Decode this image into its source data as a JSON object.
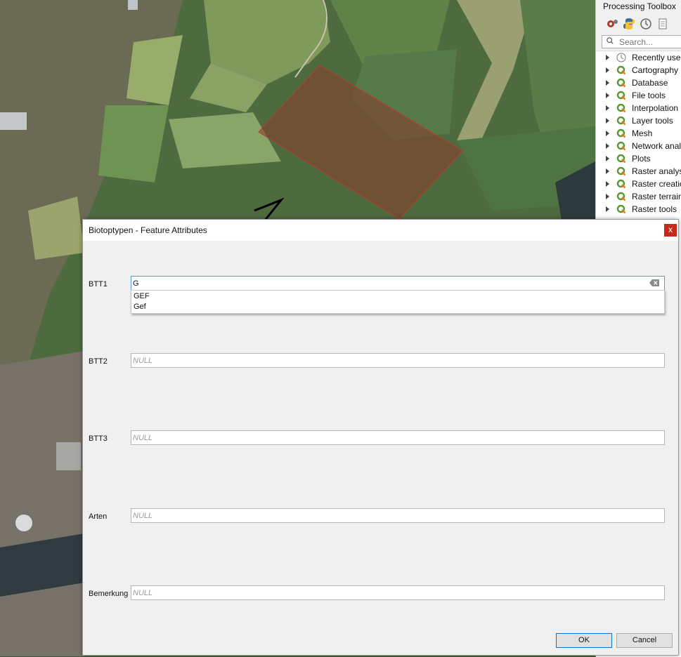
{
  "toolbox": {
    "title": "Processing Toolbox",
    "search_placeholder": "Search...",
    "items": [
      {
        "label": "Recently used",
        "icon": "clock-icon"
      },
      {
        "label": "Cartography",
        "icon": "qgis-icon"
      },
      {
        "label": "Database",
        "icon": "qgis-icon"
      },
      {
        "label": "File tools",
        "icon": "qgis-icon"
      },
      {
        "label": "Interpolation",
        "icon": "qgis-icon"
      },
      {
        "label": "Layer tools",
        "icon": "qgis-icon"
      },
      {
        "label": "Mesh",
        "icon": "qgis-icon"
      },
      {
        "label": "Network analysis",
        "icon": "qgis-icon"
      },
      {
        "label": "Plots",
        "icon": "qgis-icon"
      },
      {
        "label": "Raster analysis",
        "icon": "qgis-icon"
      },
      {
        "label": "Raster creation",
        "icon": "qgis-icon"
      },
      {
        "label": "Raster terrain",
        "icon": "qgis-icon"
      },
      {
        "label": "Raster tools",
        "icon": "qgis-icon"
      }
    ]
  },
  "dialog": {
    "title": "Biotoptypen - Feature Attributes",
    "close_label": "x",
    "fields": [
      {
        "label": "BTT1",
        "value": "G",
        "placeholder": ""
      },
      {
        "label": "BTT2",
        "value": "",
        "placeholder": "NULL"
      },
      {
        "label": "BTT3",
        "value": "",
        "placeholder": "NULL"
      },
      {
        "label": "Arten",
        "value": "",
        "placeholder": "NULL"
      },
      {
        "label": "Bemerkung",
        "value": "",
        "placeholder": "NULL"
      }
    ],
    "completer": [
      "GEF",
      "Gef"
    ],
    "ok_label": "OK",
    "cancel_label": "Cancel"
  },
  "colors": {
    "selection_polygon": "#c0392b",
    "accent": "#0078d7",
    "close_button": "#c42b1c"
  }
}
